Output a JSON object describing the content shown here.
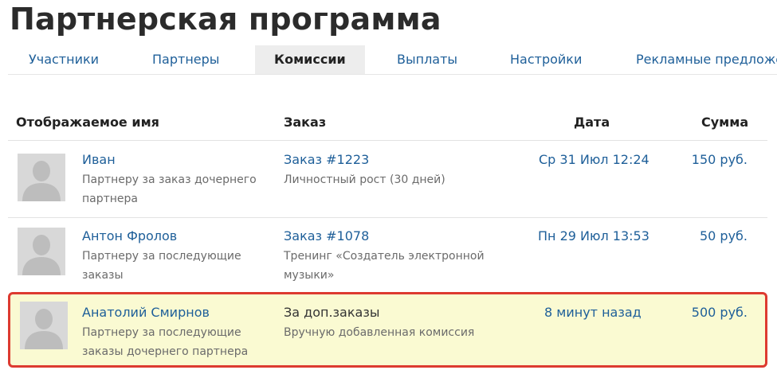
{
  "page": {
    "title": "Партнерская программа"
  },
  "tabs": [
    {
      "label": "Участники"
    },
    {
      "label": "Партнеры"
    },
    {
      "label": "Комиссии"
    },
    {
      "label": "Выплаты"
    },
    {
      "label": "Настройки"
    },
    {
      "label": "Рекламные предложе"
    }
  ],
  "active_tab": "Комиссии",
  "table": {
    "headers": {
      "name": "Отображаемое имя",
      "order": "Заказ",
      "date": "Дата",
      "amount": "Сумма"
    },
    "rows": [
      {
        "name": "Иван",
        "desc_line1": "Партнеру за заказ дочернего",
        "desc_line2": "партнера",
        "order": "Заказ #1223",
        "order_detail_line1": "Личностный рост (30 дней)",
        "order_detail_line2": "",
        "date": "Ср 31 Июл 12:24",
        "amount": "150 руб."
      },
      {
        "name": "Антон Фролов",
        "desc_line1": "Партнеру за последующие",
        "desc_line2": "заказы",
        "order": "Заказ #1078",
        "order_detail_line1": "Тренинг «Создатель электронной",
        "order_detail_line2": "музыки»",
        "date": "Пн 29 Июл 13:53",
        "amount": "50 руб."
      },
      {
        "name": "Анатолий Смирнов",
        "desc_line1": "Партнеру за последующие",
        "desc_line2": "заказы дочернего партнера",
        "order": "За доп.заказы",
        "order_detail_line1": "Вручную добавленная комиссия",
        "order_detail_line2": "",
        "date": "8 минут назад",
        "amount": "500 руб.",
        "highlighted": true
      }
    ]
  },
  "colors": {
    "link": "#1e5f99",
    "highlight_bg": "#fafad2",
    "highlight_border": "#dd3a30",
    "active_tab_bg": "#ededed"
  }
}
